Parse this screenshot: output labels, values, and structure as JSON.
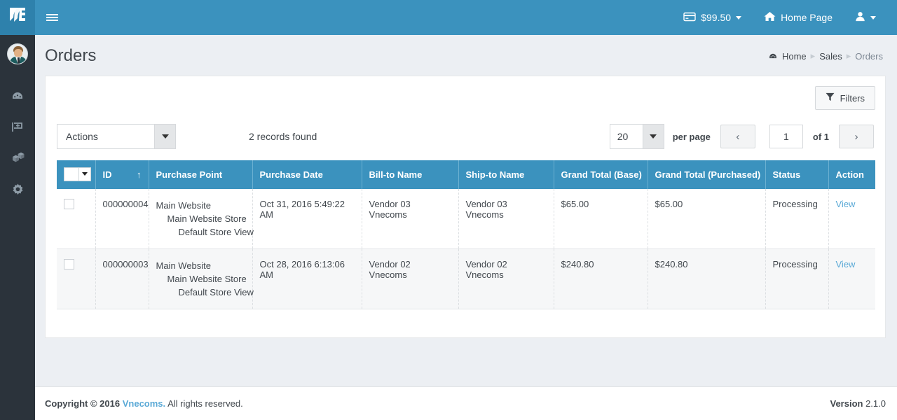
{
  "topbar": {
    "menu_icon": "hamburger-icon",
    "balance_icon": "credit-card-icon",
    "balance": "$99.50",
    "home_icon": "home-icon",
    "home_label": "Home Page",
    "user_icon": "user-icon"
  },
  "sidebar": {
    "logo_icon": "vnecoms-logo-icon",
    "avatar_icon": "user-avatar",
    "items": [
      {
        "icon": "dashboard-icon",
        "name": "dashboard"
      },
      {
        "icon": "shopping-cart-icon",
        "name": "sales"
      },
      {
        "icon": "products-boxes-icon",
        "name": "products"
      },
      {
        "icon": "gear-icon",
        "name": "settings"
      }
    ]
  },
  "page": {
    "title": "Orders",
    "breadcrumb": {
      "home_icon": "dashboard-icon",
      "items": [
        "Home",
        "Sales",
        "Orders"
      ]
    }
  },
  "toolbar": {
    "filters_icon": "funnel-icon",
    "filters_label": "Filters"
  },
  "controls": {
    "actions_label": "Actions",
    "records_found": "2 records found",
    "per_page_value": "20",
    "per_page_label": "per page",
    "prev_icon": "chevron-left-icon",
    "next_icon": "chevron-right-icon",
    "page_value": "1",
    "of_label": "of 1"
  },
  "table": {
    "mass_select_icon": "mass-select-checkbox",
    "sort_icon": "sort-asc-arrow",
    "columns": [
      "ID",
      "Purchase Point",
      "Purchase Date",
      "Bill-to Name",
      "Ship-to Name",
      "Grand Total (Base)",
      "Grand Total (Purchased)",
      "Status",
      "Action"
    ],
    "rows": [
      {
        "id": "000000004",
        "purchase_point": [
          "Main Website",
          "Main Website Store",
          "Default Store View"
        ],
        "purchase_date": "Oct 31, 2016 5:49:22 AM",
        "bill_to": "Vendor 03 Vnecoms",
        "ship_to": "Vendor 03 Vnecoms",
        "grand_total_base": "$65.00",
        "grand_total_purchased": "$65.00",
        "status": "Processing",
        "action": "View"
      },
      {
        "id": "000000003",
        "purchase_point": [
          "Main Website",
          "Main Website Store",
          "Default Store View"
        ],
        "purchase_date": "Oct 28, 2016 6:13:06 AM",
        "bill_to": "Vendor 02 Vnecoms",
        "ship_to": "Vendor 02 Vnecoms",
        "grand_total_base": "$240.80",
        "grand_total_purchased": "$240.80",
        "status": "Processing",
        "action": "View"
      }
    ]
  },
  "footer": {
    "copyright_prefix": "Copyright © 2016",
    "brand": "Vnecoms.",
    "copyright_suffix": "All rights reserved.",
    "version_label": "Version",
    "version_value": "2.1.0"
  },
  "colors": {
    "brand_blue": "#3b92be",
    "sidebar_dark": "#2b333b",
    "link_blue": "#5aa9d6",
    "page_bg": "#eceff3"
  }
}
